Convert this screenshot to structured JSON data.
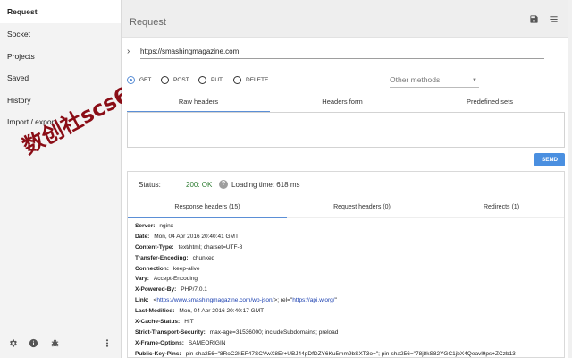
{
  "sidebar": {
    "items": [
      {
        "label": "Request",
        "active": true
      },
      {
        "label": "Socket"
      },
      {
        "label": "Projects"
      },
      {
        "label": "Saved"
      },
      {
        "label": "History"
      },
      {
        "label": "Import / export"
      }
    ],
    "footer_icons": [
      "settings-icon",
      "info-icon",
      "bug-icon",
      "more-vert-icon"
    ]
  },
  "watermark": "数创社scs66",
  "header": {
    "title": "Request",
    "icons": [
      "save-icon",
      "menu-icon"
    ]
  },
  "request": {
    "url": "https://smashingmagazine.com",
    "methods": [
      {
        "label": "GET",
        "selected": true
      },
      {
        "label": "POST"
      },
      {
        "label": "PUT"
      },
      {
        "label": "DELETE"
      }
    ],
    "other_methods": "Other methods",
    "header_tabs": [
      "Raw headers",
      "Headers form",
      "Predefined sets"
    ],
    "send_label": "SEND"
  },
  "response": {
    "status_label": "Status:",
    "status_code": "200: OK",
    "help": "?",
    "loading": "Loading time: 618 ms",
    "tabs": [
      "Response headers (15)",
      "Request headers (0)",
      "Redirects (1)"
    ],
    "headers": [
      {
        "k": "Server:",
        "v": "nginx"
      },
      {
        "k": "Date:",
        "v": "Mon, 04 Apr 2016 20:40:41 GMT"
      },
      {
        "k": "Content-Type:",
        "v": "text/html; charset=UTF-8"
      },
      {
        "k": "Transfer-Encoding:",
        "v": "chunked"
      },
      {
        "k": "Connection:",
        "v": "keep-alive"
      },
      {
        "k": "Vary:",
        "v": "Accept-Encoding"
      },
      {
        "k": "X-Powered-By:",
        "v": "PHP/7.0.1"
      },
      {
        "k": "Link:",
        "v_pre": "<",
        "link1": "https://www.smashingmagazine.com/wp-json/",
        "v_mid": ">; rel=\"",
        "link2": "https://api.w.org/",
        "v_post": "\""
      },
      {
        "k": "Last-Modified:",
        "v": "Mon, 04 Apr 2016 20:40:17 GMT"
      },
      {
        "k": "X-Cache-Status:",
        "v": "HIT"
      },
      {
        "k": "Strict-Transport-Security:",
        "v": "max-age=31536000; includeSubdomains; preload"
      },
      {
        "k": "X-Frame-Options:",
        "v": "SAMEORIGIN"
      },
      {
        "k": "Public-Key-Pins:",
        "v": "pin-sha256=\"8RoC2kEF47SCVwX8Er+UBJ44pDfDZY6Ku5mm9bSXT3o=\"; pin-sha256=\"78j8kS82YGC1jbX4Qeavl9ps+ZCzb13"
      }
    ]
  }
}
